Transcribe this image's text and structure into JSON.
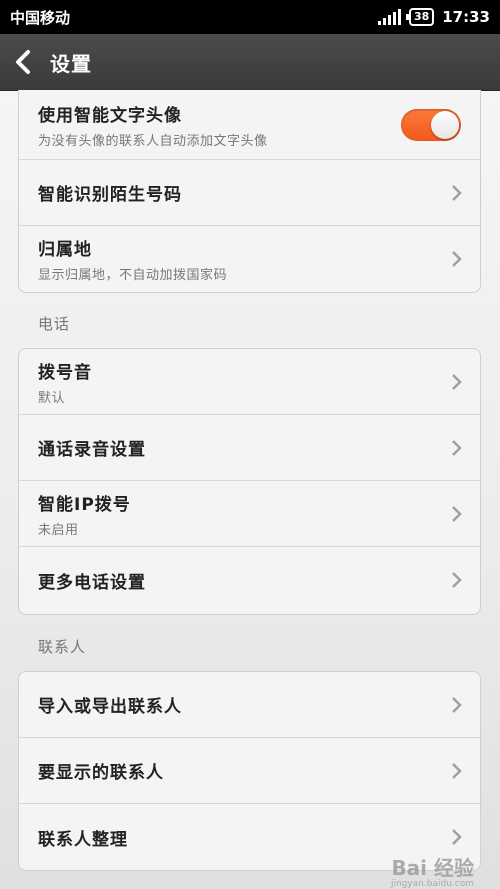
{
  "status_bar": {
    "carrier": "中国移动",
    "battery": "38",
    "time": "17:33"
  },
  "header": {
    "title": "设置"
  },
  "group1": {
    "items": [
      {
        "title": "使用智能文字头像",
        "subtitle": "为没有头像的联系人自动添加文字头像",
        "toggle_on": true
      },
      {
        "title": "智能识别陌生号码"
      },
      {
        "title": "归属地",
        "subtitle": "显示归属地，不自动加拨国家码"
      }
    ]
  },
  "phone_section": {
    "label": "电话",
    "items": [
      {
        "title": "拨号音",
        "subtitle": "默认"
      },
      {
        "title": "通话录音设置"
      },
      {
        "title": "智能IP拨号",
        "subtitle": "未启用"
      },
      {
        "title": "更多电话设置"
      }
    ]
  },
  "contacts_section": {
    "label": "联系人",
    "items": [
      {
        "title": "导入或导出联系人"
      },
      {
        "title": "要显示的联系人"
      },
      {
        "title": "联系人整理"
      }
    ]
  },
  "watermark": {
    "text": "Bai 经验",
    "sub": "jingyan.baidu.com"
  },
  "colors": {
    "accent": "#f05a1a",
    "header_bg": "#3f3f41"
  }
}
